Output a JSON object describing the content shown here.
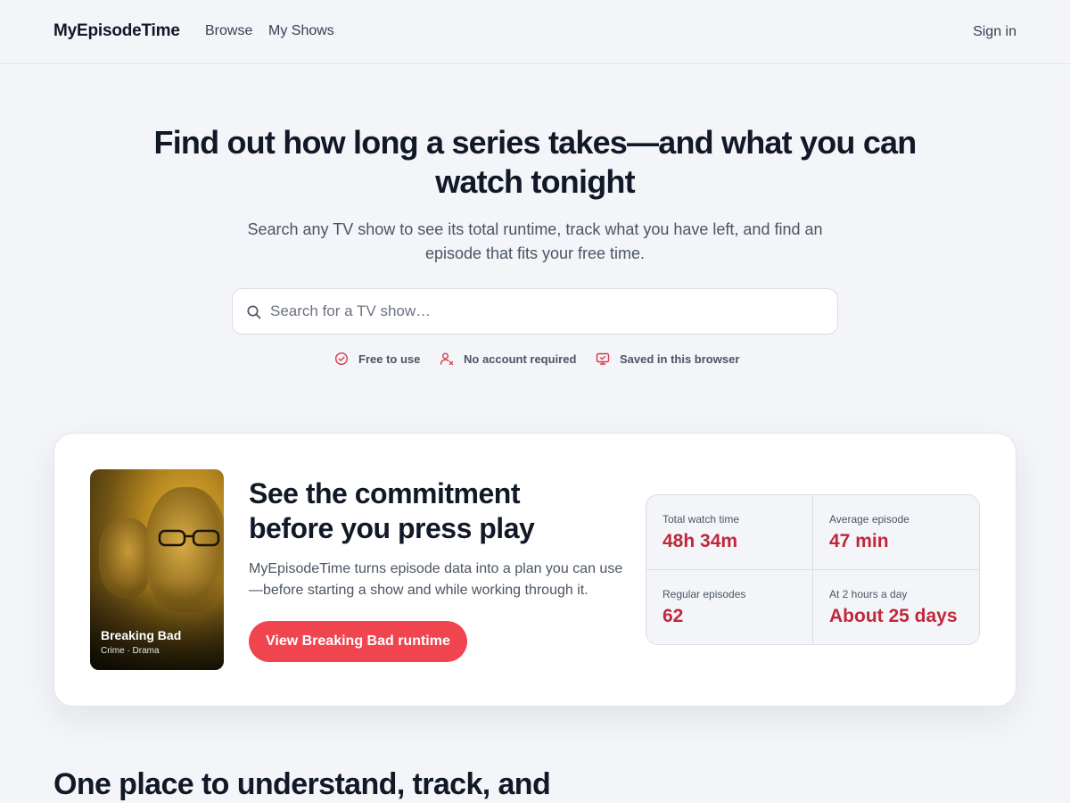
{
  "header": {
    "brand": "MyEpisodeTime",
    "nav": [
      "Browse",
      "My Shows"
    ],
    "signin": "Sign in"
  },
  "hero": {
    "title": "Find out how long a series takes—and what you can watch tonight",
    "subtitle": "Search any TV show to see its total runtime, track what you have left, and find an episode that fits your free time.",
    "search_placeholder": "Search for a TV show…",
    "features": [
      "Free to use",
      "No account required",
      "Saved in this browser"
    ]
  },
  "feature_card": {
    "poster": {
      "title": "Breaking Bad",
      "genres": "Crime · Drama"
    },
    "title": "See the commitment before you press play",
    "text": "MyEpisodeTime turns episode data into a plan you can use—before starting a show and while working through it.",
    "cta": "View Breaking Bad runtime",
    "stats": [
      {
        "label": "Total watch time",
        "value": "48h 34m"
      },
      {
        "label": "Average episode",
        "value": "47 min"
      },
      {
        "label": "Regular episodes",
        "value": "62"
      },
      {
        "label": "At 2 hours a day",
        "value": "About 25 days"
      }
    ]
  },
  "section": {
    "title": "One place to understand, track, and"
  },
  "colors": {
    "accent": "#f0454f",
    "stat_value": "#c0283a",
    "background": "#f3f5f9"
  }
}
